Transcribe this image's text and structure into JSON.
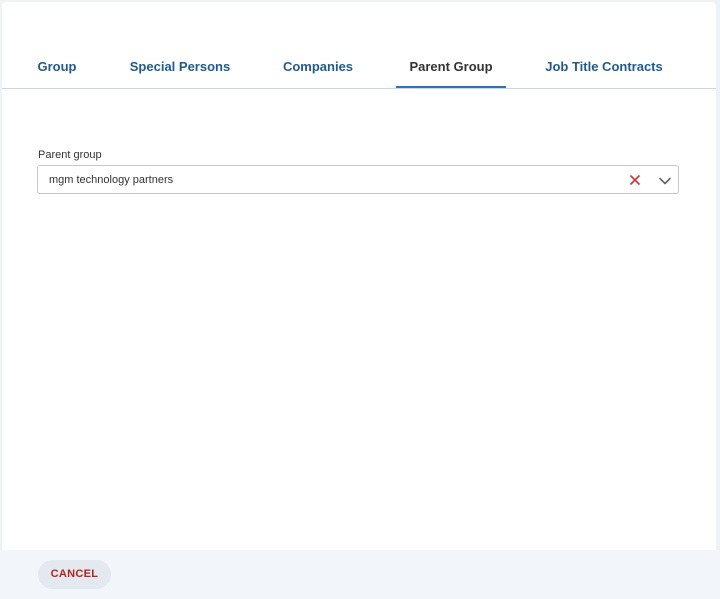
{
  "tabs": [
    {
      "label": "Group",
      "active": false
    },
    {
      "label": "Special Persons",
      "active": false
    },
    {
      "label": "Companies",
      "active": false
    },
    {
      "label": "Parent Group",
      "active": true
    },
    {
      "label": "Job Title Contracts",
      "active": false
    }
  ],
  "parent_group": {
    "label": "Parent group",
    "value": "mgm technology partners",
    "clear_icon": "close-icon",
    "dropdown_icon": "chevron-down-icon"
  },
  "footer": {
    "cancel_label": "CANCEL"
  },
  "colors": {
    "tab_text": "#1f5a94",
    "tab_active_text": "#333333",
    "tab_active_underline": "#2a74b8",
    "clear_icon": "#d32f2f",
    "cancel_text": "#b3261e",
    "footer_background": "#f2f5f9"
  }
}
